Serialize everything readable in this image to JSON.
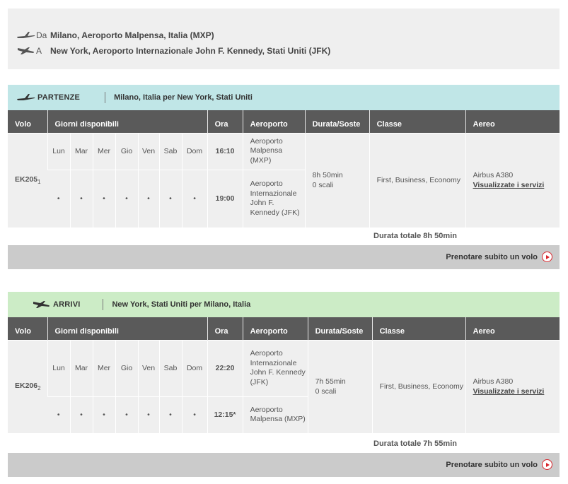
{
  "route": {
    "from_prefix": "Da",
    "from": "Milano, Aeroporto Malpensa, Italia (MXP)",
    "to_prefix": "A",
    "to": "New York, Aeroporto Internazionale John F. Kennedy, Stati Uniti (JFK)"
  },
  "columns": {
    "volo": "Volo",
    "giorni": "Giorni disponibili",
    "ora": "Ora",
    "aeroporto": "Aeroporto",
    "durata": "Durata/Soste",
    "classe": "Classe",
    "aereo": "Aereo"
  },
  "days": [
    "Lun",
    "Mar",
    "Mer",
    "Gio",
    "Ven",
    "Sab",
    "Dom"
  ],
  "dot": "•",
  "departures": {
    "label": "PARTENZE",
    "title": "Milano, Italia per New York, Stati Uniti",
    "flight_number": "EK205",
    "flight_sub": "1",
    "dep_time": "16:10",
    "dep_airport": "Aeroporto Malpensa (MXP)",
    "arr_time": "19:00",
    "arr_airport": "Aeroporto Internazionale John F. Kennedy (JFK)",
    "duration": "8h 50min",
    "stops": "0 scali",
    "class": "First, Business, Economy",
    "aircraft": "Airbus A380",
    "services_link": "Visualizzate i servizi",
    "total": "Durata totale 8h 50min",
    "book": "Prenotare subito un volo"
  },
  "arrivals": {
    "label": "ARRIVI",
    "title": "New York, Stati Uniti per Milano, Italia",
    "flight_number": "EK206",
    "flight_sub": "2",
    "dep_time": "22:20",
    "dep_airport": "Aeroporto Internazionale John F. Kennedy (JFK)",
    "arr_time": "12:15*",
    "arr_airport": "Aeroporto Malpensa (MXP)",
    "duration": "7h 55min",
    "stops": "0 scali",
    "class": "First, Business, Economy",
    "aircraft": "Airbus A380",
    "services_link": "Visualizzate i servizi",
    "total": "Durata totale 7h 55min",
    "book": "Prenotare subito un volo"
  }
}
